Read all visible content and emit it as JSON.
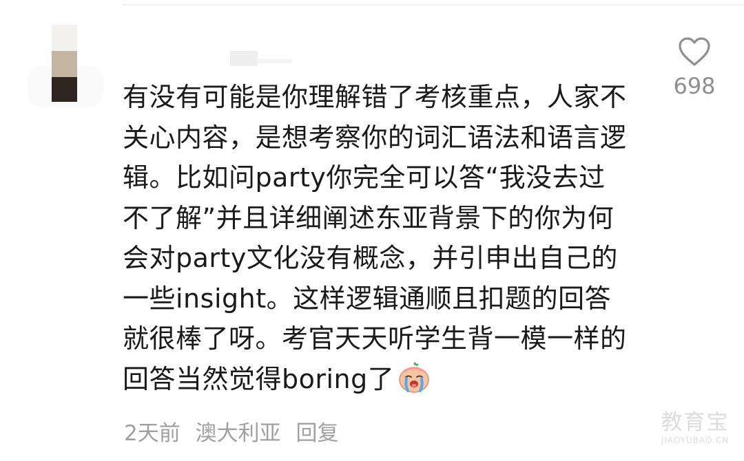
{
  "comment": {
    "lines": [
      "有没有可能是你理解错了考核重点，人家不",
      "关心内容，是想考察你的词汇语法和语言逻",
      "辑。比如问party你完全可以答“我没去过",
      "不了解”并且详细阐述东亚背景下的你为何",
      "会对party文化没有概念，并引申出自己的",
      "一些insight。这样逻辑通顺且扣题的回答",
      "就很棒了呀。考官天天听学生背一模一样的",
      "回答当然觉得boring了"
    ],
    "emoji_icon": "crying-face-emoji-icon"
  },
  "meta": {
    "time": "2天前",
    "location": "澳大利亚",
    "reply": "回复"
  },
  "like": {
    "icon": "heart-outline-icon",
    "count": "698"
  },
  "watermark": {
    "main": "教育宝",
    "sub": "JIAOYUBAO.CN"
  },
  "colors": {
    "text": "#1a1a1a",
    "meta": "#a0a0a0",
    "like": "#8f8f8f"
  }
}
